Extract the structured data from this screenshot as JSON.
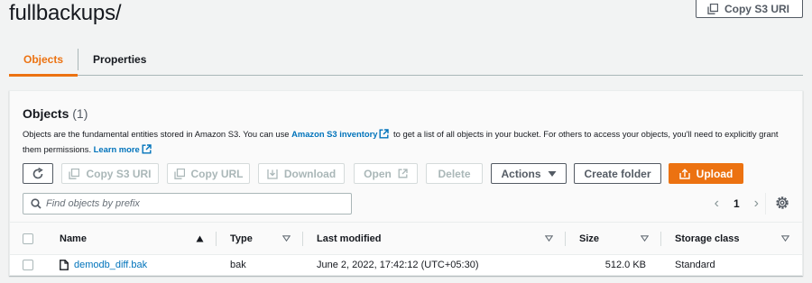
{
  "header": {
    "title": "fullbackups/",
    "copy_s3_uri_label": "Copy S3 URI"
  },
  "tabs": [
    {
      "label": "Objects",
      "active": true
    },
    {
      "label": "Properties",
      "active": false
    }
  ],
  "objects_panel": {
    "title": "Objects",
    "count": "(1)",
    "description_part1": "Objects are the fundamental entities stored in Amazon S3. You can use ",
    "inventory_link": "Amazon S3 inventory",
    "description_part2": " to get a list of all objects in your bucket. For others to access your objects, you'll need to explicitly grant them permissions. ",
    "learn_more_link": "Learn more"
  },
  "toolbar": {
    "copy_s3_uri": "Copy S3 URI",
    "copy_url": "Copy URL",
    "download": "Download",
    "open": "Open",
    "delete": "Delete",
    "actions": "Actions",
    "create_folder": "Create folder",
    "upload": "Upload"
  },
  "search": {
    "placeholder": "Find objects by prefix",
    "value": ""
  },
  "pagination": {
    "current_page": "1"
  },
  "table": {
    "columns": [
      "Name",
      "Type",
      "Last modified",
      "Size",
      "Storage class"
    ],
    "rows": [
      {
        "name": "demodb_diff.bak",
        "type": "bak",
        "last_modified": "June 2, 2022, 17:42:12 (UTC+05:30)",
        "size": "512.0 KB",
        "storage_class": "Standard"
      }
    ]
  },
  "colors": {
    "accent": "#ec7211",
    "link": "#0073bb",
    "text": "#16191f"
  }
}
